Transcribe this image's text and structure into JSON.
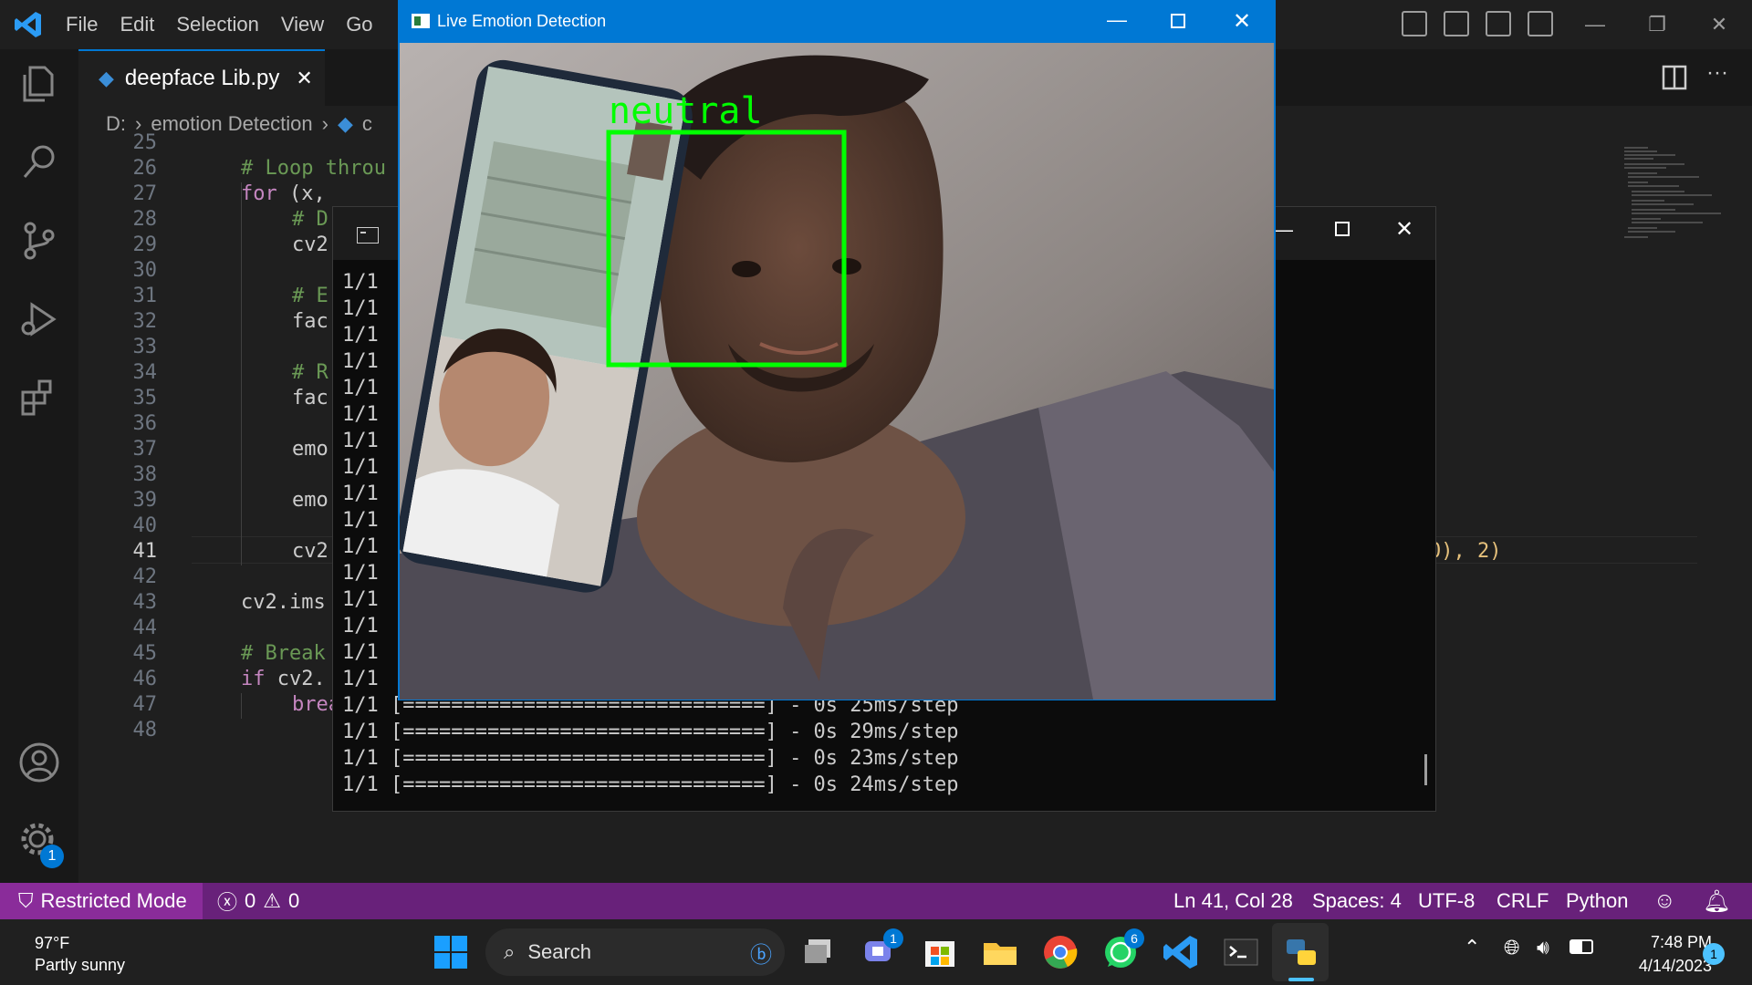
{
  "vscode": {
    "menu": [
      "File",
      "Edit",
      "Selection",
      "View",
      "Go"
    ],
    "tab": {
      "filename": "deepface Lib.py"
    },
    "breadcrumb": {
      "drive": "D:",
      "folder": "emotion Detection",
      "file_prefix": "c"
    },
    "line_numbers": [
      "25",
      "26",
      "27",
      "28",
      "29",
      "30",
      "31",
      "32",
      "33",
      "34",
      "35",
      "36",
      "37",
      "38",
      "39",
      "40",
      "41",
      "42",
      "43",
      "44",
      "45",
      "46",
      "47",
      "48"
    ],
    "code": {
      "l26": "# Loop throu",
      "l27_kw": "for",
      "l27_rest": " (x,",
      "l28": "# D",
      "l29": "cv2",
      "l31": "# E",
      "l32": "fac",
      "l34": "# R",
      "l35": "fac",
      "l37": "emo",
      "l39": "emo",
      "l41": "cv2",
      "l41_tail": "0), 2)",
      "l43": "cv2.ims",
      "l45": "# Break",
      "l46_kw": "if",
      "l46_rest": " cv2.",
      "l47_kw": "break"
    },
    "status": {
      "restricted": "Restricted Mode",
      "errors": "0",
      "warnings": "0",
      "position": "Ln 41, Col 28",
      "spaces": "Spaces: 4",
      "encoding": "UTF-8",
      "eol": "CRLF",
      "language": "Python"
    },
    "accent_color": "#0078d4",
    "statusbar_color": "#68217a"
  },
  "console": {
    "progress_lines": [
      "1/1",
      "1/1",
      "1/1",
      "1/1",
      "1/1",
      "1/1",
      "1/1",
      "1/1",
      "1/1",
      "1/1",
      "1/1",
      "1/1",
      "1/1",
      "1/1",
      "1/1",
      "1/1"
    ],
    "full_lines": [
      "1/1 [==============================] - 0s 25ms/step",
      "1/1 [==============================] - 0s 29ms/step",
      "1/1 [==============================] - 0s 23ms/step",
      "1/1 [==============================] - 0s 24ms/step"
    ]
  },
  "emotion_window": {
    "title": "Live Emotion Detection",
    "detected_emotion": "neutral",
    "box_color": "#00ff00"
  },
  "taskbar": {
    "weather_temp": "97°F",
    "weather_desc": "Partly sunny",
    "search_placeholder": "Search",
    "time": "7:48 PM",
    "date": "4/14/2023",
    "teams_badge": "1",
    "whatsapp_badge": "6",
    "notification_count": "1",
    "settings_badge": "1"
  }
}
